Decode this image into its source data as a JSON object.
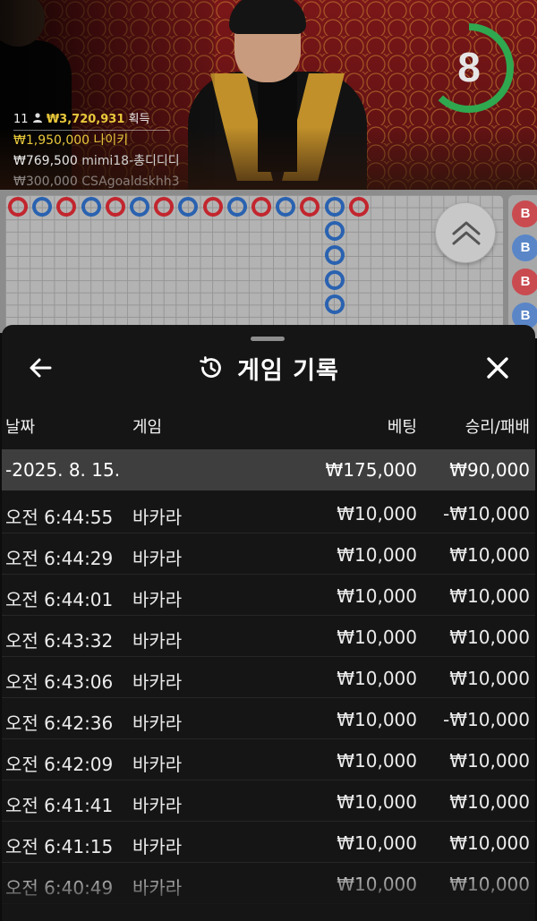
{
  "stream": {
    "timer_value": "8",
    "timer_fraction": 0.62,
    "accent_color": "#2fa84f",
    "winners": {
      "count": "11",
      "total_amount": "₩3,720,931",
      "total_suffix": "획득",
      "entries": [
        {
          "amount": "₩1,950,000",
          "name": "나이키"
        },
        {
          "amount": "₩769,500",
          "name": "mimi18-총디디디"
        },
        {
          "amount": "₩300,000",
          "name": "CSAgoaldskhh3"
        }
      ]
    }
  },
  "road": {
    "top_row": [
      "r",
      "b",
      "r",
      "b",
      "r",
      "b",
      "r",
      "b",
      "r",
      "b",
      "r",
      "b",
      "r",
      "b",
      "r"
    ],
    "column": [
      "b",
      "b",
      "b",
      "b"
    ],
    "side_labels": [
      "B",
      "B",
      "B",
      "B"
    ],
    "colors": {
      "banker": "#c2262e",
      "player": "#2a62b0"
    }
  },
  "history": {
    "title": "게임 기록",
    "headers": {
      "date": "날짜",
      "game": "게임",
      "bet": "베팅",
      "win_loss": "승리/패배"
    },
    "summary": {
      "date": "-2025. 8. 15.",
      "bet": "₩175,000",
      "win_loss": "₩90,000"
    },
    "rows": [
      {
        "time": "오전 6:44:55",
        "game": "바카라",
        "bet": "₩10,000",
        "win_loss": "-₩10,000"
      },
      {
        "time": "오전 6:44:29",
        "game": "바카라",
        "bet": "₩10,000",
        "win_loss": "₩10,000"
      },
      {
        "time": "오전 6:44:01",
        "game": "바카라",
        "bet": "₩10,000",
        "win_loss": "₩10,000"
      },
      {
        "time": "오전 6:43:32",
        "game": "바카라",
        "bet": "₩10,000",
        "win_loss": "₩10,000"
      },
      {
        "time": "오전 6:43:06",
        "game": "바카라",
        "bet": "₩10,000",
        "win_loss": "₩10,000"
      },
      {
        "time": "오전 6:42:36",
        "game": "바카라",
        "bet": "₩10,000",
        "win_loss": "-₩10,000"
      },
      {
        "time": "오전 6:42:09",
        "game": "바카라",
        "bet": "₩10,000",
        "win_loss": "₩10,000"
      },
      {
        "time": "오전 6:41:41",
        "game": "바카라",
        "bet": "₩10,000",
        "win_loss": "₩10,000"
      },
      {
        "time": "오전 6:41:15",
        "game": "바카라",
        "bet": "₩10,000",
        "win_loss": "₩10,000"
      },
      {
        "time": "오전 6:40:49",
        "game": "바카라",
        "bet": "₩10,000",
        "win_loss": "₩10,000"
      }
    ]
  }
}
